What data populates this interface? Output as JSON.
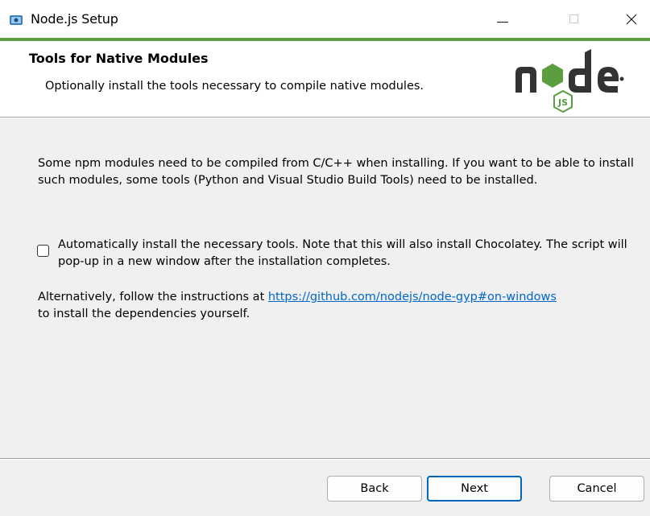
{
  "window": {
    "title": "Node.js Setup",
    "icons": {
      "app": "installer-icon",
      "minimize": "minimize-icon",
      "maximize": "maximize-icon",
      "close": "close-icon"
    },
    "close_glyph": "✕"
  },
  "header": {
    "title": "Tools for Native Modules",
    "subtitle": "Optionally install the tools necessary to compile native modules.",
    "logo": {
      "word": "node",
      "badge": "JS",
      "accent_color": "#5a9e3f",
      "text_color": "#333333"
    }
  },
  "body": {
    "paragraph1": "Some npm modules need to be compiled from C/C++ when installing. If you want to be able to install such modules, some tools (Python and Visual Studio Build Tools) need to be installed.",
    "checkbox": {
      "label": "Automatically install the necessary tools. Note that this will also install Chocolatey. The script will pop-up in a new window after the installation completes.",
      "checked": false
    },
    "paragraph3_prefix": "Alternatively, follow the instructions at ",
    "link_text": "https://github.com/nodejs/node-gyp#on-windows",
    "paragraph3_suffix": " to install the dependencies yourself."
  },
  "footer": {
    "back_label": "Back",
    "next_label": "Next",
    "cancel_label": "Cancel"
  },
  "colors": {
    "accent": "#5a9e3f",
    "link": "#0066cc",
    "focus_border": "#0067c0"
  }
}
